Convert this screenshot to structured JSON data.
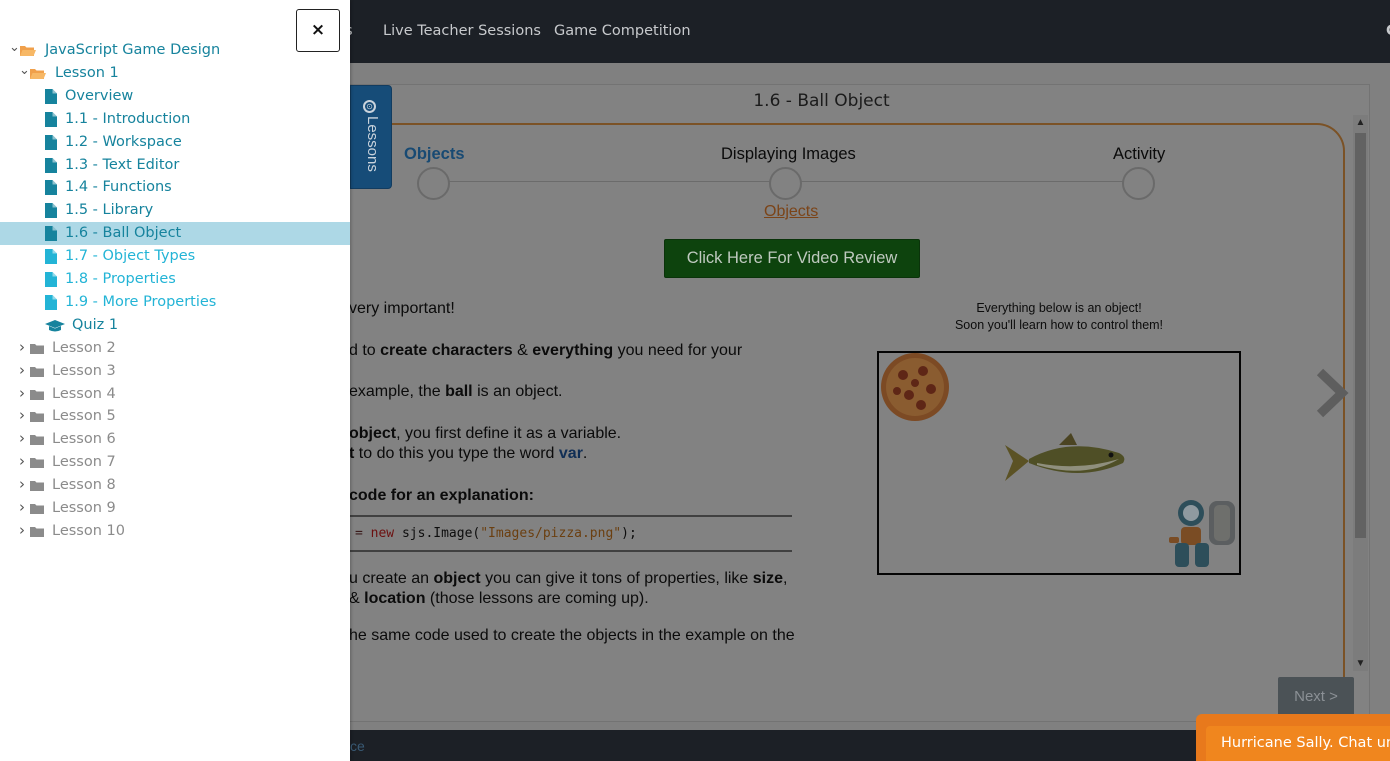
{
  "topnav": {
    "items": [
      "s",
      "Live Teacher Sessions",
      "Game Competition",
      "C"
    ]
  },
  "lesson_page": {
    "title": "1.6 - Ball Object",
    "lessons_tab_label": "Lessons",
    "steps": [
      "Objects",
      "Displaying Images",
      "Activity"
    ],
    "current_step_link": "Objects",
    "video_button": "Click Here For Video Review",
    "paragraphs": {
      "p1": "very important!",
      "p2_pre": "d to ",
      "p2_b1": "create characters",
      "p2_mid": " & ",
      "p2_b2": "everything",
      "p2_post": " you need for your",
      "p3_pre": "example, the ",
      "p3_b": "ball",
      "p3_post": " is an object.",
      "p4a_b": "object",
      "p4a_post": ", you first define it as a variable.",
      "p4b_b": "t",
      "p4b_mid": " to do this you type the word ",
      "p4b_var": "var",
      "p4b_post": ".",
      "p5_b": " code for an explanation:",
      "p6a_pre": "u create an ",
      "p6a_b1": "object",
      "p6a_mid": " you can give it tons of properties, like ",
      "p6a_b2": "size",
      "p6a_post": ",",
      "p6b_pre": "& ",
      "p6b_b": "location",
      "p6b_post": " (those lessons are coming up).",
      "p7": "he same code used to create the objects in the example on the"
    },
    "code": {
      "eq": "= ",
      "new": "new",
      "call": " sjs.Image(",
      "str": "\"Images/pizza.png\"",
      "end": ");"
    },
    "demo_caption": [
      "Everything below is an object!",
      "Soon you'll learn how to control them!"
    ],
    "next_button": "Next >",
    "footer_text": "ce",
    "chat_text": "Hurricane Sally. Chat und"
  },
  "drawer": {
    "close_label": "×",
    "tree": [
      {
        "label": "JavaScript Game Design",
        "icon": "folder-open-icon",
        "caret": "down",
        "style": "teal"
      },
      {
        "label": "Lesson 1",
        "icon": "folder-open-icon",
        "caret": "down",
        "style": "teal"
      },
      {
        "label": "Overview",
        "icon": "file-icon",
        "style": "teal"
      },
      {
        "label": "1.1 - Introduction",
        "icon": "file-icon",
        "style": "teal"
      },
      {
        "label": "1.2 - Workspace",
        "icon": "file-icon",
        "style": "teal"
      },
      {
        "label": "1.3 - Text Editor",
        "icon": "file-icon",
        "style": "teal"
      },
      {
        "label": "1.4 - Functions",
        "icon": "file-icon",
        "style": "teal"
      },
      {
        "label": "1.5 - Library",
        "icon": "file-icon",
        "style": "teal"
      },
      {
        "label": "1.6 - Ball Object",
        "icon": "file-icon",
        "style": "teal",
        "active": true
      },
      {
        "label": "1.7 - Object Types",
        "icon": "file-icon",
        "style": "light"
      },
      {
        "label": "1.8 - Properties",
        "icon": "file-icon",
        "style": "light"
      },
      {
        "label": "1.9 - More Properties",
        "icon": "file-icon",
        "style": "light"
      },
      {
        "label": "Quiz 1",
        "icon": "graduation-cap-icon",
        "style": "teal"
      },
      {
        "label": "Lesson 2",
        "icon": "folder-icon",
        "caret": "right",
        "style": "gray"
      },
      {
        "label": "Lesson 3",
        "icon": "folder-icon",
        "caret": "right",
        "style": "gray"
      },
      {
        "label": "Lesson 4",
        "icon": "folder-icon",
        "caret": "right",
        "style": "gray"
      },
      {
        "label": "Lesson 5",
        "icon": "folder-icon",
        "caret": "right",
        "style": "gray"
      },
      {
        "label": "Lesson 6",
        "icon": "folder-icon",
        "caret": "right",
        "style": "gray"
      },
      {
        "label": "Lesson 7",
        "icon": "folder-icon",
        "caret": "right",
        "style": "gray"
      },
      {
        "label": "Lesson 8",
        "icon": "folder-icon",
        "caret": "right",
        "style": "gray"
      },
      {
        "label": "Lesson 9",
        "icon": "folder-icon",
        "caret": "right",
        "style": "gray"
      },
      {
        "label": "Lesson 10",
        "icon": "folder-icon",
        "caret": "right",
        "style": "gray"
      }
    ]
  },
  "colors": {
    "drawer_active_bg": "#add8e6",
    "tree_teal": "#16839d",
    "tree_light": "#23b4d6",
    "tree_gray": "#8b8b8b",
    "folder_orange": "#f0a04b",
    "chat_orange": "#f0861e"
  }
}
